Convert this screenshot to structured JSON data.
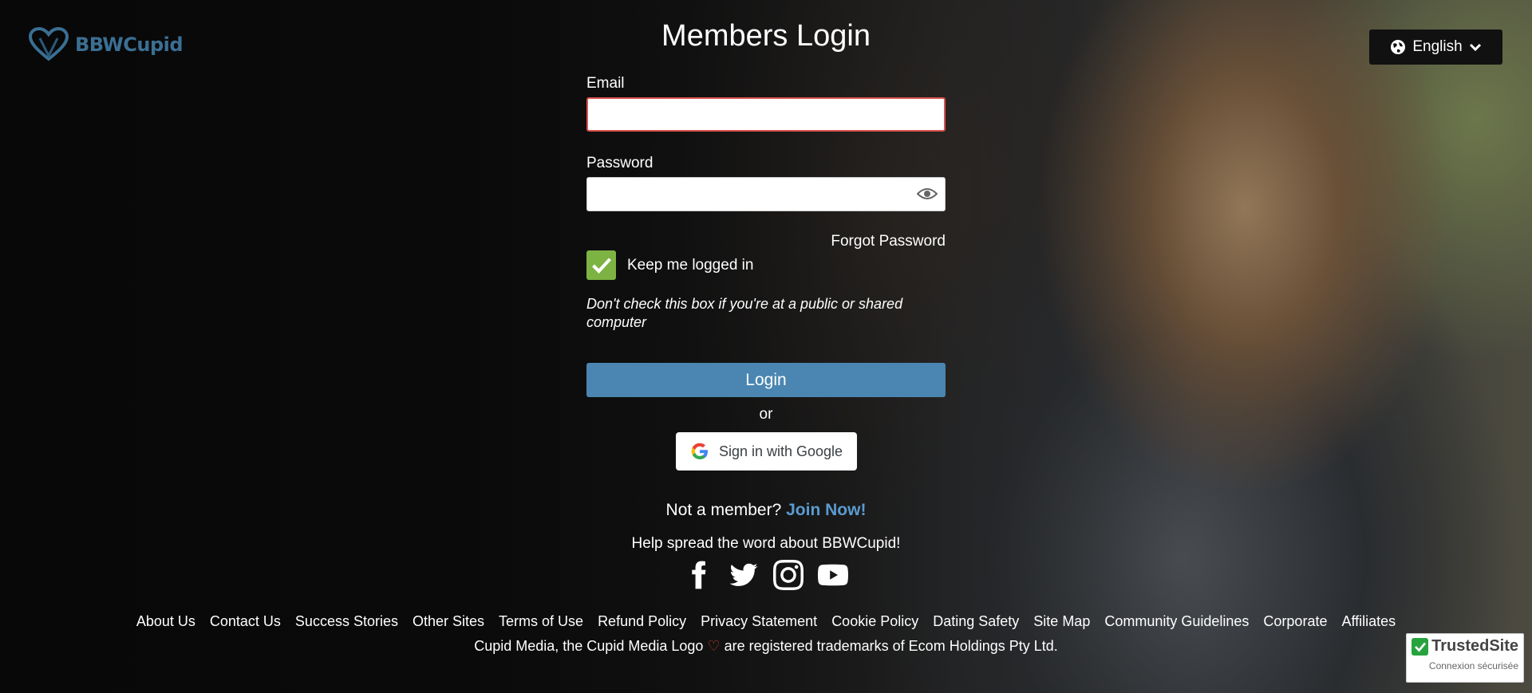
{
  "brand": {
    "name": "BBWCupid",
    "color": "#3b6f93"
  },
  "header": {
    "title": "Members Login",
    "language": "English"
  },
  "form": {
    "email_label": "Email",
    "email_value": "",
    "password_label": "Password",
    "password_value": "",
    "forgot_password": "Forgot Password",
    "keep_logged_in": "Keep me logged in",
    "keep_logged_in_checked": true,
    "hint": "Don't check this box if you're at a public or shared computer",
    "login_button": "Login",
    "or": "or",
    "google_button": "Sign in with Google"
  },
  "signup": {
    "prompt": "Not a member?",
    "link": "Join Now!"
  },
  "share": {
    "text": "Help spread the word about BBWCupid!",
    "icons": [
      "facebook-icon",
      "twitter-icon",
      "instagram-icon",
      "youtube-icon"
    ]
  },
  "footer": {
    "links": [
      "About Us",
      "Contact Us",
      "Success Stories",
      "Other Sites",
      "Terms of Use",
      "Refund Policy",
      "Privacy Statement",
      "Cookie Policy",
      "Dating Safety",
      "Site Map",
      "Community Guidelines",
      "Corporate",
      "Affiliates"
    ],
    "trademark_pre": "Cupid Media, the Cupid Media Logo",
    "trademark_post": "are registered trademarks of Ecom Holdings Pty Ltd."
  },
  "trusted": {
    "name": "TrustedSite",
    "sub": "Connexion sécurisée"
  },
  "colors": {
    "accent": "#4a86b1",
    "checkbox": "#7cb342",
    "join_link": "#5b9bd1",
    "error_border": "#d9534f"
  }
}
